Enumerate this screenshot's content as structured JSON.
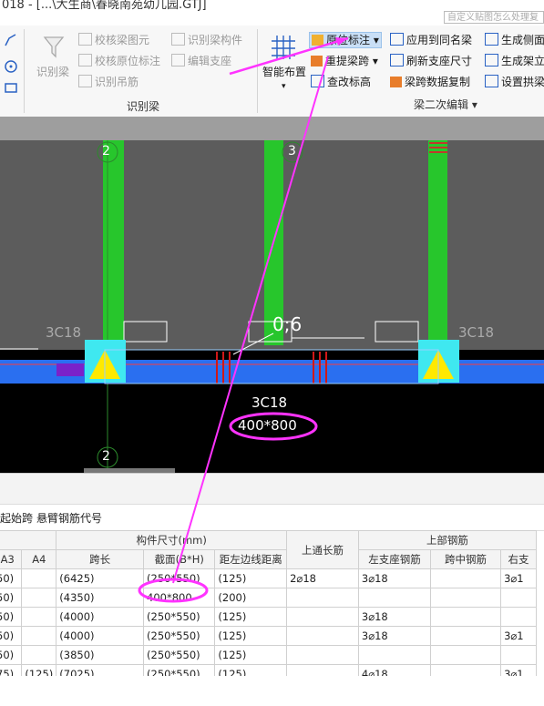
{
  "window": {
    "title": "018 - [...\\大生商\\春晓南苑幼儿园.GTJ]",
    "search_placeholder": "自定义贴图怎么处理复"
  },
  "ribbon": {
    "identify_group": {
      "big_button": "识别梁",
      "items": [
        "校核梁图元",
        "校核原位标注",
        "识别吊筋",
        "识别梁构件",
        "编辑支座"
      ],
      "label": "识别梁"
    },
    "smart_layout": {
      "label": "智能布置"
    },
    "edit_group": {
      "items": [
        "原位标注",
        "重提梁跨",
        "查改标高",
        "应用到同名梁",
        "刷新支座尺寸",
        "梁跨数据复制",
        "生成侧面",
        "生成架立",
        "设置拱梁"
      ],
      "label": "梁二次编辑"
    }
  },
  "canvas": {
    "axis_labels": [
      "2",
      "3",
      "2"
    ],
    "rebar_labels": [
      "3C18",
      "3C18",
      "3C18"
    ],
    "annotation": "0;6",
    "section_label": "400*800"
  },
  "table": {
    "tabs": [
      "起始跨",
      "悬臂钢筋代号"
    ],
    "group_headers": {
      "size": "构件尺寸(mm)",
      "top_long": "上通长筋",
      "top_rebar": "上部钢筋"
    },
    "columns": [
      "A3",
      "A4",
      "跨长",
      "截面(B*H)",
      "距左边线距离",
      "",
      "左支座钢筋",
      "跨中钢筋",
      "右支"
    ],
    "rows": [
      [
        "50)",
        "",
        "(6425)",
        "(250*550)",
        "(125)",
        "2⌀18",
        "3⌀18",
        "",
        "3⌀1"
      ],
      [
        "50)",
        "",
        "(4350)",
        "400*800",
        "(200)",
        "",
        "",
        "",
        ""
      ],
      [
        "50)",
        "",
        "(4000)",
        "(250*550)",
        "(125)",
        "",
        "3⌀18",
        "",
        ""
      ],
      [
        "50)",
        "",
        "(4000)",
        "(250*550)",
        "(125)",
        "",
        "3⌀18",
        "",
        "3⌀1"
      ],
      [
        "50)",
        "",
        "(3850)",
        "(250*550)",
        "(125)",
        "",
        "",
        "",
        ""
      ],
      [
        "75)",
        "(125)",
        "(7025)",
        "(250*550)",
        "(125)",
        "",
        "4⌀18",
        "",
        "3⌀1"
      ]
    ]
  }
}
